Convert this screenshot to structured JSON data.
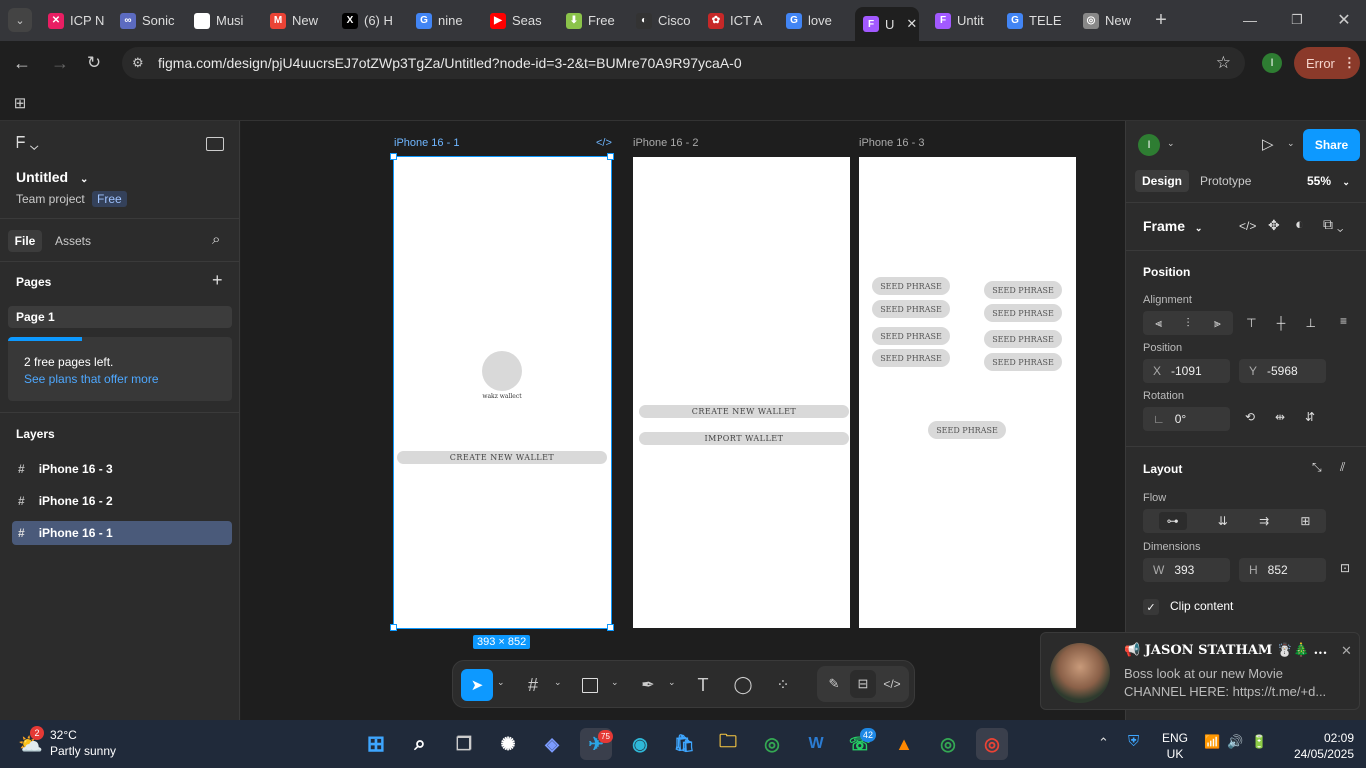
{
  "browser": {
    "tabs": [
      {
        "label": "ICP N",
        "color": "#e91e63",
        "glyph": "✕"
      },
      {
        "label": "Sonic",
        "color": "#5c6bc0",
        "glyph": "∞"
      },
      {
        "label": "Musi",
        "color": "#ffffff",
        "glyph": "W"
      },
      {
        "label": "New",
        "color": "#ea4335",
        "glyph": "M"
      },
      {
        "label": "(6) H",
        "color": "#000000",
        "glyph": "X"
      },
      {
        "label": "nine",
        "color": "#4285f4",
        "glyph": "G"
      },
      {
        "label": "Seas",
        "color": "#ff0000",
        "glyph": "▶"
      },
      {
        "label": "Free",
        "color": "#8bc34a",
        "glyph": "⬇"
      },
      {
        "label": "Cisco",
        "color": "#333333",
        "glyph": "◐"
      },
      {
        "label": "ICT A",
        "color": "#c62828",
        "glyph": "✿"
      },
      {
        "label": "love",
        "color": "#4285f4",
        "glyph": "G"
      },
      {
        "label": "U",
        "color": "#a259ff",
        "glyph": "F"
      },
      {
        "label": "Untit",
        "color": "#a259ff",
        "glyph": "F"
      },
      {
        "label": "TELE",
        "color": "#4285f4",
        "glyph": "G"
      },
      {
        "label": "New",
        "color": "#888888",
        "glyph": "◎"
      }
    ],
    "url": "figma.com/design/pjU4uucrsEJ7otZWp3TgZa/Untitled?node-id=3-2&t=BUMre70A9R97ycaA-0",
    "profile_initial": "I",
    "error_label": "Error"
  },
  "figma": {
    "file_title": "Untitled",
    "team": "Team project",
    "plan_badge": "Free",
    "tabs": {
      "file": "File",
      "assets": "Assets"
    },
    "pages_heading": "Pages",
    "page_1": "Page 1",
    "free_pages_note": "2 free pages left.",
    "see_plans": "See plans that offer more",
    "layers_heading": "Layers",
    "layers": [
      "iPhone 16 - 3",
      "iPhone 16 - 2",
      "iPhone 16 - 1"
    ],
    "frames": {
      "f1": {
        "title": "iPhone 16 - 1",
        "wallet_name": "wakz wallect",
        "create_btn": "CREATE NEW WALLET",
        "size_badge": "393 × 852"
      },
      "f2": {
        "title": "iPhone 16 - 2",
        "create_btn": "CREATE NEW WALLET",
        "import_btn": "IMPORT WALLET"
      },
      "f3": {
        "title": "iPhone 16 - 3",
        "seed": [
          "SEED PHRASE",
          "SEED PHRASE",
          "SEED PHRASE",
          "SEED PHRASE",
          "SEED PHRASE",
          "SEED PHRASE",
          "SEED PHRASE",
          "SEED PHRASE",
          "SEED PHRASE"
        ]
      }
    },
    "right": {
      "avatar": "I",
      "share": "Share",
      "tab_design": "Design",
      "tab_prototype": "Prototype",
      "zoom": "55%",
      "frame_label": "Frame",
      "position_heading": "Position",
      "alignment_label": "Alignment",
      "position_label": "Position",
      "x_label": "X",
      "x_value": "-1091",
      "y_label": "Y",
      "y_value": "-5968",
      "rotation_label": "Rotation",
      "rotation_value": "0°",
      "layout_heading": "Layout",
      "flow_label": "Flow",
      "dimensions_label": "Dimensions",
      "w_label": "W",
      "w_value": "393",
      "h_label": "H",
      "h_value": "852",
      "clip_content": "Clip content"
    }
  },
  "notification": {
    "title": "📢 JASON STATHAM ☃️🎄 ...",
    "line1": "Boss look at our new Movie",
    "line2": "CHANNEL HERE: https://t.me/+d..."
  },
  "taskbar": {
    "weather_badge": "2",
    "temp": "32°C",
    "condition": "Partly sunny",
    "telegram_badge": "75",
    "whatsapp_badge": "42",
    "lang1": "ENG",
    "lang2": "UK",
    "time": "02:09",
    "date": "24/05/2025"
  }
}
